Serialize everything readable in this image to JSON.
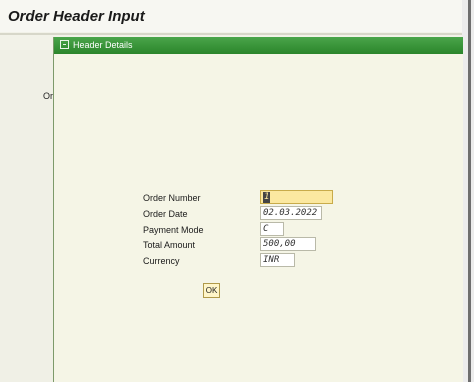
{
  "page": {
    "title": "Order Header Input",
    "background_label": "Ord"
  },
  "dialog": {
    "title": "Header Details",
    "fields": [
      {
        "label": "Order Number",
        "value": "1"
      },
      {
        "label": "Order Date",
        "value": "02.03.2022"
      },
      {
        "label": "Payment Mode",
        "value": "C"
      },
      {
        "label": "Total Amount",
        "value": "500,00"
      },
      {
        "label": "Currency",
        "value": "INR"
      }
    ],
    "ok_label": "OK"
  },
  "colors": {
    "titlebar": "#2f8a2f",
    "active_field": "#fbe8a0",
    "dialog_background": "#f5f5e6"
  }
}
